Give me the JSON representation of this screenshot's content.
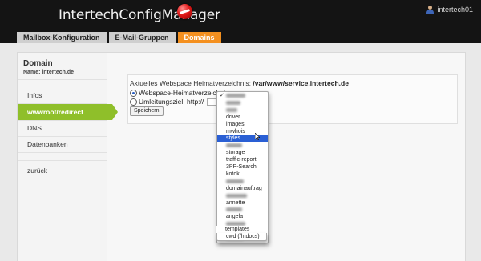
{
  "app": {
    "title": "IntertechConfigManager",
    "user": "intertech01"
  },
  "tabs": [
    {
      "label": "Mailbox-Konfiguration"
    },
    {
      "label": "E-Mail-Gruppen"
    },
    {
      "label": "Domains"
    }
  ],
  "sidebar": {
    "title": "Domain",
    "subtitle": "Name: intertech.de",
    "items": [
      {
        "label": "Infos"
      },
      {
        "label": "wwwroot/redirect"
      },
      {
        "label": "DNS"
      },
      {
        "label": "Datenbanken"
      },
      {
        "label": "zurück"
      }
    ]
  },
  "content": {
    "current_label": "Aktuelles Webspace Heimatverzeichnis:",
    "current_value": "/var/www/service.intertech.de",
    "option_webspace": "Webspace-Heimatverzeichnis",
    "option_redirect": "Umleitungsziel: http://",
    "save_label": "Speichern"
  },
  "dropdown": {
    "check_mark": "✓",
    "items": [
      {
        "label": "driver"
      },
      {
        "label": "images"
      },
      {
        "label": "mwhois"
      },
      {
        "label": "styles"
      },
      {
        "label": "storage"
      },
      {
        "label": "traffic-report"
      },
      {
        "label": "3PP-Search"
      },
      {
        "label": "kotok"
      },
      {
        "label": "domainauftrag"
      },
      {
        "label": "annette"
      },
      {
        "label": "angela"
      },
      {
        "label": "templates"
      },
      {
        "label": "cwd (/htdocs)"
      }
    ]
  },
  "colors": {
    "active_tab": "#f4901f",
    "active_sidebar": "#8fbf2a",
    "highlight": "#2a5fd4"
  }
}
